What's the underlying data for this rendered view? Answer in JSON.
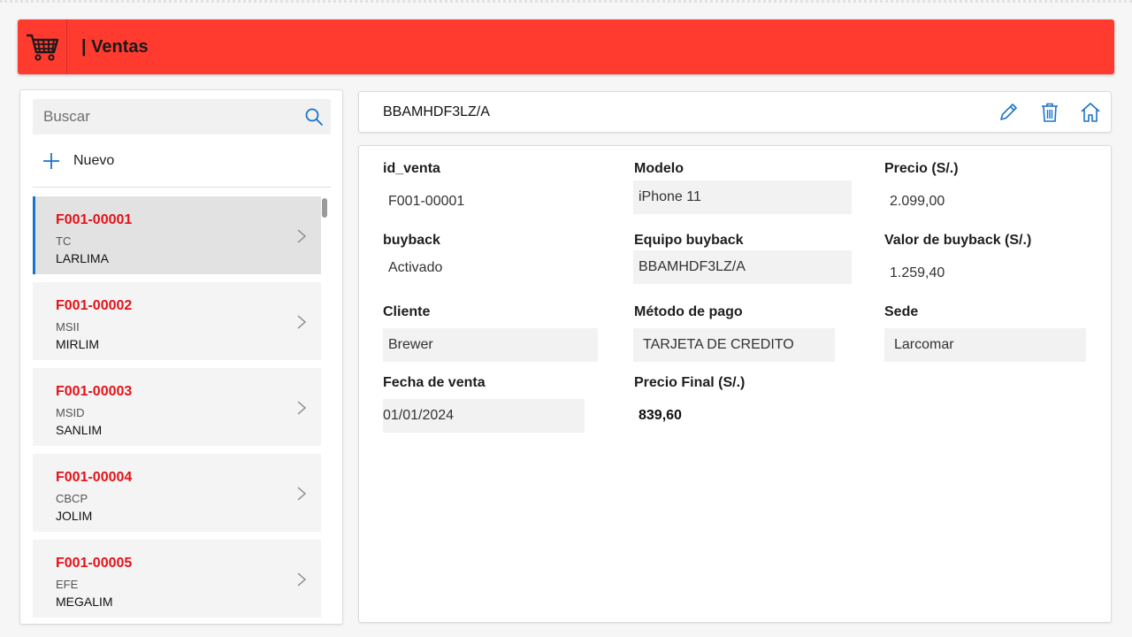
{
  "header": {
    "title": "| Ventas",
    "icon": "shopping-cart-icon",
    "color": "#ff3b30"
  },
  "search": {
    "placeholder": "Buscar"
  },
  "new_button": {
    "label": "Nuevo"
  },
  "list": {
    "accent_color": "#1a73c8",
    "items": [
      {
        "code": "F001-00001",
        "sub": "TC",
        "place": "LARLIMA"
      },
      {
        "code": "F001-00002",
        "sub": "MSII",
        "place": "MIRLIM"
      },
      {
        "code": "F001-00003",
        "sub": "MSID",
        "place": "SANLIM"
      },
      {
        "code": "F001-00004",
        "sub": "CBCP",
        "place": "JOLIM"
      },
      {
        "code": "F001-00005",
        "sub": "EFE",
        "place": "MEGALIM"
      }
    ]
  },
  "topbar": {
    "title": "BBAMHDF3LZ/A",
    "icons": [
      "pencil-icon",
      "trash-icon",
      "home-icon"
    ],
    "icon_color": "#1a73c8"
  },
  "detail": {
    "id_venta": {
      "label": "id_venta",
      "value": "F001-00001"
    },
    "modelo": {
      "label": "Modelo",
      "value": "iPhone 11"
    },
    "precio": {
      "label": "Precio (S/.)",
      "value": "2.099,00"
    },
    "buyback": {
      "label": "buyback",
      "value": "Activado"
    },
    "equipo_buyback": {
      "label": "Equipo buyback",
      "value": "BBAMHDF3LZ/A"
    },
    "valor_buyback": {
      "label": "Valor de buyback (S/.)",
      "value": "1.259,40"
    },
    "cliente": {
      "label": "Cliente",
      "value": "Brewer"
    },
    "metodo_pago": {
      "label": "Método de pago",
      "value": "TARJETA DE CREDITO"
    },
    "sede": {
      "label": "Sede",
      "value": "Larcomar"
    },
    "fecha_venta": {
      "label": "Fecha de venta",
      "value": "01/01/2024"
    },
    "precio_final": {
      "label": "Precio Final (S/.)",
      "value": "839,60"
    }
  }
}
